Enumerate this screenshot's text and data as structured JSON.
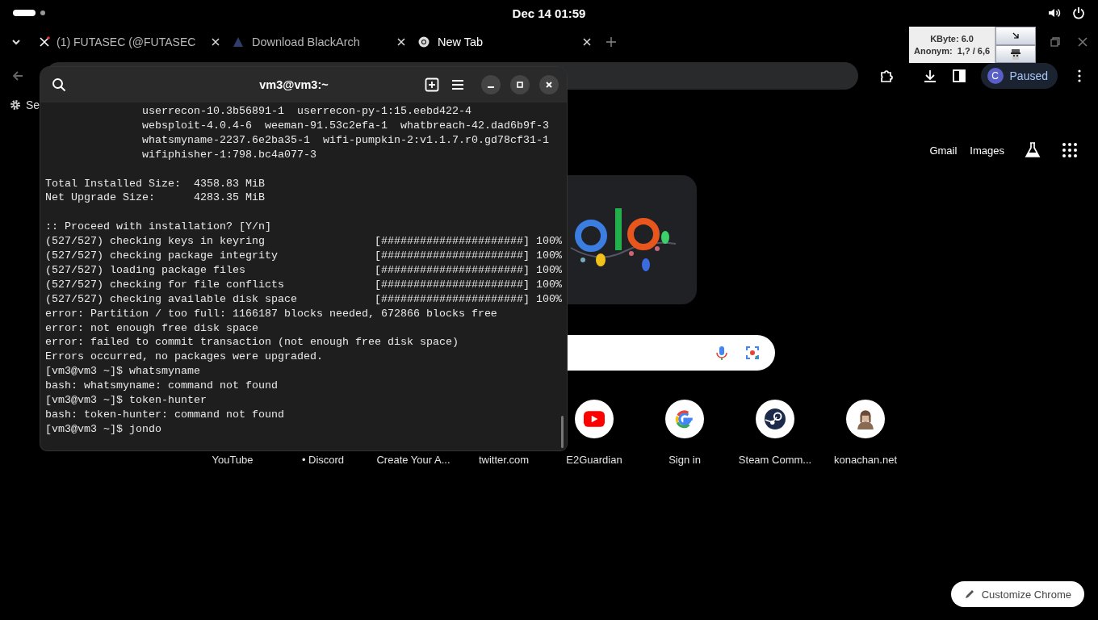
{
  "top_bar": {
    "clock": "Dec 14  01:59"
  },
  "browser": {
    "tabs": [
      {
        "title": "(1) FUTASEC (@FUTASEC",
        "selected": false
      },
      {
        "title": "Download BlackArch",
        "selected": false
      },
      {
        "title": "New Tab",
        "selected": true
      }
    ],
    "jondo": {
      "lines": [
        "KByte: 6.0",
        "Anonym:  1,? / 6,6"
      ]
    },
    "profile": {
      "initial": "C",
      "status": "Paused"
    },
    "bookmarks": [
      {
        "label": "Se"
      }
    ],
    "header_links": [
      "Gmail",
      "Images"
    ],
    "shortcuts": [
      {
        "label": "YouTube",
        "kind": "covered"
      },
      {
        "label": "• Discord",
        "kind": "covered"
      },
      {
        "label": "Create Your A...",
        "kind": "covered"
      },
      {
        "label": "twitter.com",
        "kind": "covered"
      },
      {
        "label": "E2Guardian",
        "kind": "youtube"
      },
      {
        "label": "Sign in",
        "kind": "google"
      },
      {
        "label": "Steam Comm...",
        "kind": "steam"
      },
      {
        "label": "konachan.net",
        "kind": "avatar"
      }
    ],
    "customize_button": "Customize Chrome"
  },
  "terminal": {
    "title": "vm3@vm3:~",
    "blocks": [
      [
        {
          "kind": "indented",
          "text": "userrecon-10.3b56891-1  userrecon-py-1:15.eebd422-4"
        },
        {
          "kind": "indented",
          "text": "websploit-4.0.4-6  weeman-91.53c2efa-1  whatbreach-42.dad6b9f-3"
        },
        {
          "kind": "indented",
          "text": "whatsmyname-2237.6e2ba35-1  wifi-pumpkin-2:v1.1.7.r0.gd78cf31-1"
        },
        {
          "kind": "indented",
          "text": "wifiphisher-1:798.bc4a077-3"
        }
      ],
      [
        {
          "kind": "text",
          "text": "Total Installed Size:  4358.83 MiB"
        },
        {
          "kind": "text",
          "text": "Net Upgrade Size:      4283.35 MiB"
        }
      ],
      [
        {
          "kind": "text",
          "text": ":: Proceed with installation? [Y/n]"
        },
        {
          "kind": "progress",
          "text": "(527/527) checking keys in keyring",
          "bar": "[######################]",
          "percent": "100%"
        },
        {
          "kind": "progress",
          "text": "(527/527) checking package integrity",
          "bar": "[######################]",
          "percent": "100%"
        },
        {
          "kind": "progress",
          "text": "(527/527) loading package files",
          "bar": "[######################]",
          "percent": "100%"
        },
        {
          "kind": "progress",
          "text": "(527/527) checking for file conflicts",
          "bar": "[######################]",
          "percent": "100%"
        },
        {
          "kind": "progress",
          "text": "(527/527) checking available disk space",
          "bar": "[######################]",
          "percent": "100%"
        },
        {
          "kind": "text",
          "text": "error: Partition / too full: 1166187 blocks needed, 672866 blocks free"
        },
        {
          "kind": "text",
          "text": "error: not enough free disk space"
        },
        {
          "kind": "text",
          "text": "error: failed to commit transaction (not enough free disk space)"
        },
        {
          "kind": "text",
          "text": "Errors occurred, no packages were upgraded."
        },
        {
          "kind": "text",
          "text": "[vm3@vm3 ~]$ whatsmyname"
        },
        {
          "kind": "text",
          "text": "bash: whatsmyname: command not found"
        },
        {
          "kind": "text",
          "text": "[vm3@vm3 ~]$ token-hunter"
        },
        {
          "kind": "text",
          "text": "bash: token-hunter: command not found"
        },
        {
          "kind": "text",
          "text": "[vm3@vm3 ~]$ jondo"
        }
      ]
    ]
  }
}
